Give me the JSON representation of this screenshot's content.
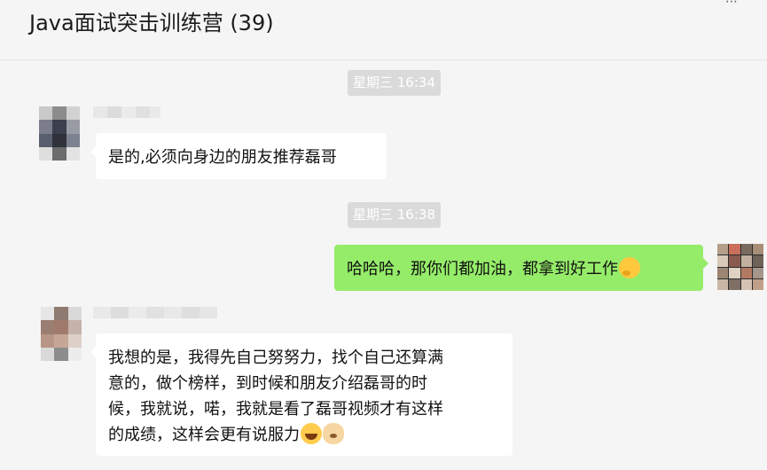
{
  "header": {
    "title": "Java面试突击训练营 (39)"
  },
  "messages": [
    {
      "type": "time",
      "text": "星期三 16:34"
    },
    {
      "type": "received",
      "text": "是的,必须向身边的朋友推荐磊哥"
    },
    {
      "type": "time",
      "text": "星期三 16:38"
    },
    {
      "type": "sent",
      "text": "哈哈哈，那你们都加油，都拿到好工作",
      "emoji": "thinking-face-emoji"
    },
    {
      "type": "received",
      "lines": [
        "我想的是，我得先自己努努力，找个自己还算满",
        "意的，做个榜样，到时候和朋友介绍磊哥的时",
        "候，我就说，喏，我就是看了磊哥视频才有这样",
        "的成绩，这样会更有说服力"
      ],
      "emojis": [
        "laughing-tears-emoji",
        "doge-emoji"
      ]
    }
  ],
  "colors": {
    "sent_bubble": "#95ec69",
    "received_bubble": "#ffffff",
    "time_chip": "#dadada",
    "background": "#f5f5f5"
  }
}
